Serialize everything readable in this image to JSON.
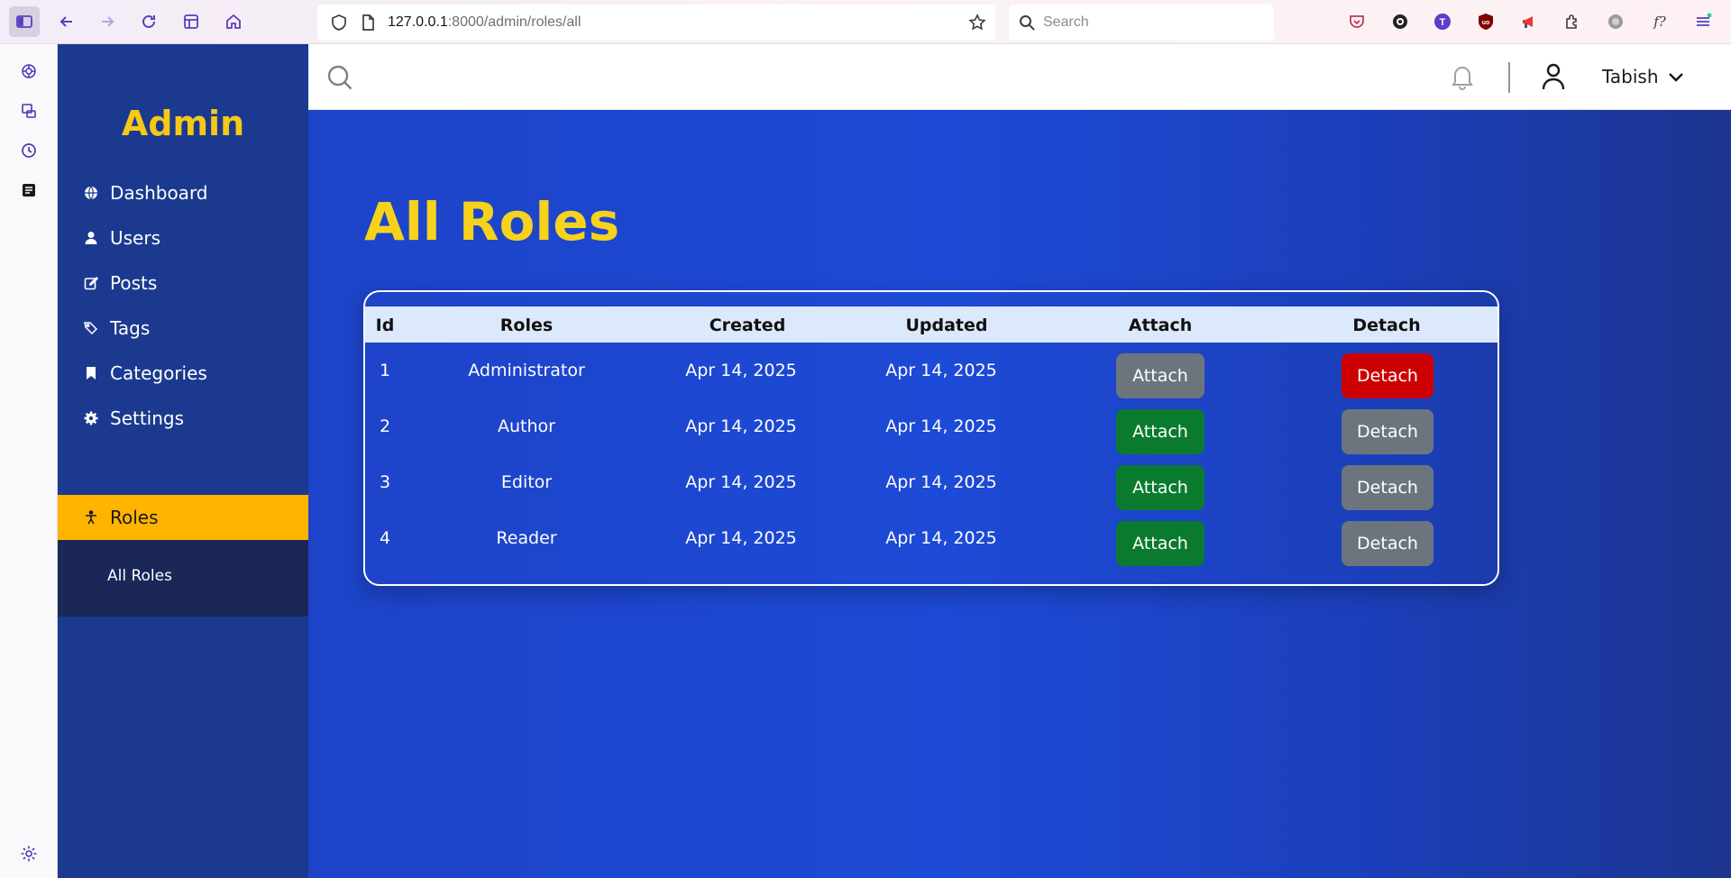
{
  "browser": {
    "url_host": "127.0.0.1",
    "url_path": ":8000/admin/roles/all",
    "search_placeholder": "Search"
  },
  "sidebar": {
    "brand": "Admin",
    "items": [
      {
        "label": "Dashboard",
        "icon": "globe-icon"
      },
      {
        "label": "Users",
        "icon": "user-icon"
      },
      {
        "label": "Posts",
        "icon": "edit-icon"
      },
      {
        "label": "Tags",
        "icon": "tags-icon"
      },
      {
        "label": "Categories",
        "icon": "bookmark-icon"
      },
      {
        "label": "Settings",
        "icon": "gear-icon"
      },
      {
        "label": "Roles",
        "icon": "person-icon",
        "active": true
      }
    ],
    "submenu": {
      "label": "All Roles"
    }
  },
  "header": {
    "username": "Tabish"
  },
  "main": {
    "title": "All Roles",
    "table": {
      "columns": [
        "Id",
        "Roles",
        "Created",
        "Updated",
        "Attach",
        "Detach"
      ],
      "rows": [
        {
          "id": "1",
          "role": "Administrator",
          "created": "Apr 14, 2025",
          "updated": "Apr 14, 2025",
          "attach": "Attach",
          "detach": "Detach",
          "attach_color": "#6c757d",
          "detach_color": "#cc0000"
        },
        {
          "id": "2",
          "role": "Author",
          "created": "Apr 14, 2025",
          "updated": "Apr 14, 2025",
          "attach": "Attach",
          "detach": "Detach",
          "attach_color": "#0a7a2f",
          "detach_color": "#6c757d"
        },
        {
          "id": "3",
          "role": "Editor",
          "created": "Apr 14, 2025",
          "updated": "Apr 14, 2025",
          "attach": "Attach",
          "detach": "Detach",
          "attach_color": "#0a7a2f",
          "detach_color": "#6c757d"
        },
        {
          "id": "4",
          "role": "Reader",
          "created": "Apr 14, 2025",
          "updated": "Apr 14, 2025",
          "attach": "Attach",
          "detach": "Detach",
          "attach_color": "#0a7a2f",
          "detach_color": "#6c757d"
        }
      ]
    }
  },
  "colors": {
    "accent_yellow": "#f6d21c",
    "sidebar_active": "#ffb400",
    "attach_active": "#0a7a2f",
    "detach_active": "#cc0000",
    "disabled_gray": "#6c757d"
  }
}
